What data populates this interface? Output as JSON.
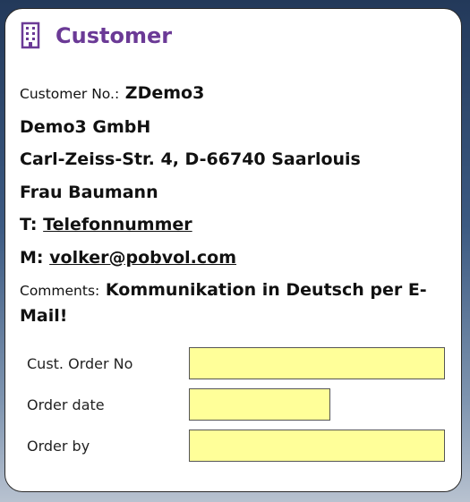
{
  "header": {
    "icon": "building-icon",
    "title": "Customer",
    "accent_color": "#6b3a96"
  },
  "customer": {
    "number_label": "Customer No.:",
    "number": "ZDemo3",
    "company": "Demo3 GmbH",
    "address": "Carl-Zeiss-Str. 4, D-66740 Saarlouis",
    "contact": "Frau Baumann",
    "phone_prefix": "T:",
    "phone": "Telefonnummer",
    "mail_prefix": "M:",
    "email": "volker@pobvol.com",
    "comments_label": "Comments:",
    "comments": "Kommunikation in Deutsch per E-Mail!"
  },
  "form": {
    "cust_order_no_label": "Cust. Order No",
    "cust_order_no_value": "",
    "order_date_label": "Order date",
    "order_date_value": "",
    "order_by_label": "Order by",
    "order_by_value": "",
    "input_color": "#ffff99"
  }
}
